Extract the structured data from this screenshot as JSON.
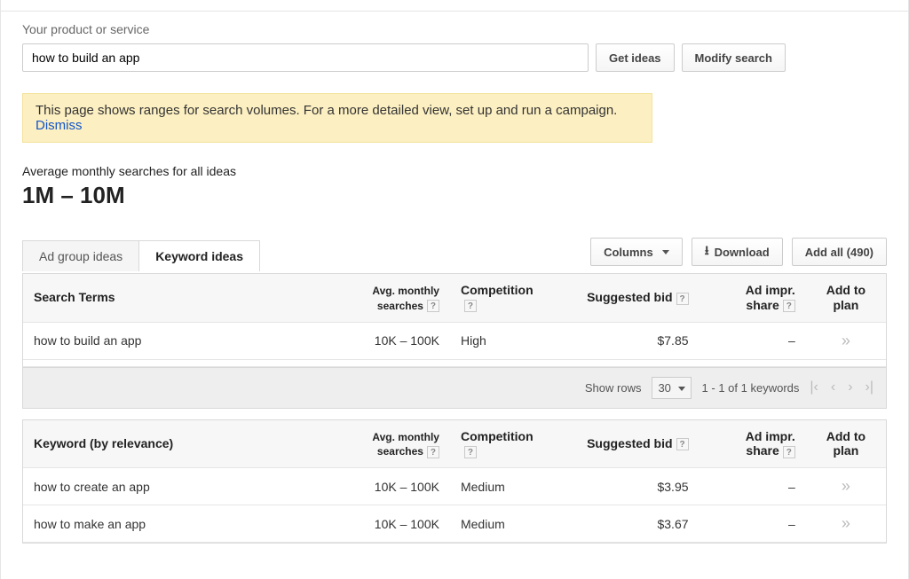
{
  "label_product": "Your product or service",
  "search_value": "how to build an app",
  "btn_get_ideas": "Get ideas",
  "btn_modify_search": "Modify search",
  "notice_text": "This page shows ranges for search volumes. For a more detailed view, set up and run a campaign. ",
  "notice_dismiss": "Dismiss",
  "avg_monthly_label": "Average monthly searches for all ideas",
  "avg_monthly_value": "1M – 10M",
  "tabs": {
    "ad_group": "Ad group ideas",
    "keyword": "Keyword ideas"
  },
  "actions": {
    "columns": "Columns",
    "download": "Download",
    "add_all": "Add all (490)"
  },
  "columns": {
    "search_terms": "Search Terms",
    "keyword_by_relevance": "Keyword (by relevance)",
    "avg_monthly": "Avg. monthly",
    "searches": "searches",
    "competition": "Competition",
    "suggested_bid": "Suggested bid",
    "ad_impr_share": "Ad impr. share",
    "add_to_plan": "Add to plan"
  },
  "table1": [
    {
      "term": "how to build an app",
      "avg": "10K – 100K",
      "comp": "High",
      "bid": "$7.85",
      "share": "–"
    }
  ],
  "pager": {
    "show_rows_label": "Show rows",
    "show_rows_value": "30",
    "range_text": "1 - 1 of 1 keywords"
  },
  "table2": [
    {
      "term": "how to create an app",
      "avg": "10K – 100K",
      "comp": "Medium",
      "bid": "$3.95",
      "share": "–"
    },
    {
      "term": "how to make an app",
      "avg": "10K – 100K",
      "comp": "Medium",
      "bid": "$3.67",
      "share": "–"
    }
  ]
}
